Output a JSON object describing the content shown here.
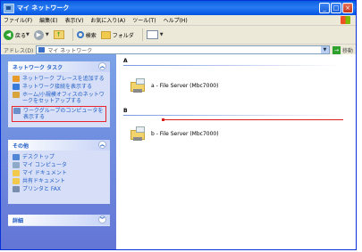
{
  "window": {
    "title": "マイ ネットワーク"
  },
  "menu": [
    "ファイル(F)",
    "編集(E)",
    "表示(V)",
    "お気に入り(A)",
    "ツール(T)",
    "ヘルプ(H)"
  ],
  "toolbar": {
    "back": "戻る",
    "search": "検索",
    "folders": "フォルダ"
  },
  "address": {
    "label": "アドレス(D)",
    "value": "マイ ネットワーク",
    "go": "移動"
  },
  "tasks": {
    "title": "ネットワーク タスク",
    "items": [
      {
        "label": "ネットワーク プレースを追加する",
        "icon": "add-place-icon"
      },
      {
        "label": "ネットワーク接続を表示する",
        "icon": "network-connections-icon"
      },
      {
        "label": "ホーム/小規模オフィスのネットワークをセットアップする",
        "icon": "setup-network-icon"
      },
      {
        "label": "ワークグループのコンピュータを表示する",
        "icon": "workgroup-computers-icon"
      }
    ]
  },
  "other": {
    "title": "その他",
    "items": [
      "デスクトップ",
      "マイ コンピュータ",
      "マイ ドキュメント",
      "共有ドキュメント",
      "プリンタと FAX"
    ]
  },
  "details": {
    "title": "詳細"
  },
  "groups": [
    {
      "header": "A",
      "server": "a - File Server (Mbc7000)"
    },
    {
      "header": "B",
      "server": "b - File Server (Mbc7000)"
    }
  ],
  "colors": {
    "title_bar": "#0054e3",
    "task_pane": "#6375d6",
    "link_text": "#215dc6",
    "highlight_red": "#e8232a"
  }
}
